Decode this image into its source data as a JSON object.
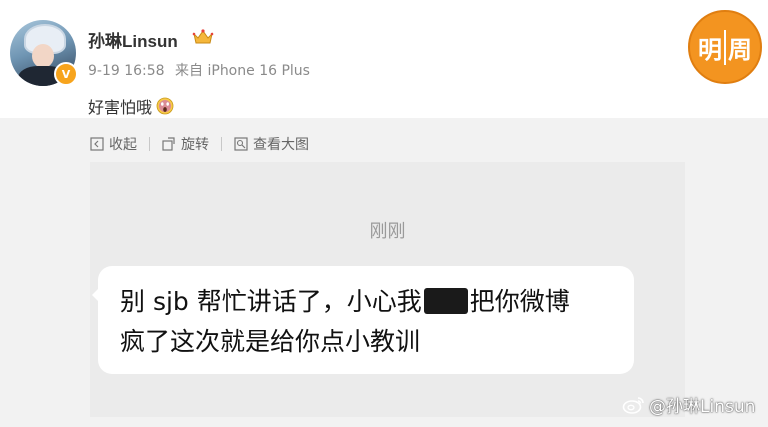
{
  "post": {
    "username": "孙琳Linsun",
    "time": "9-19 16:58",
    "source": "来自 iPhone 16 Plus",
    "text": "好害怕哦"
  },
  "logo": {
    "char1": "明",
    "char2": "周"
  },
  "toolbar": {
    "collapse_label": "收起",
    "rotate_label": "旋转",
    "view_large_label": "查看大图"
  },
  "chat_screenshot": {
    "time_label": "刚刚",
    "line1_before": "别 sjb 帮忙讲话了，小心我",
    "line1_after": "把你微博",
    "line2": "疯了这次就是给你点小教训"
  },
  "watermark": {
    "text": "@孙琳Linsun"
  },
  "colors": {
    "verified_badge": "#f7a41d",
    "logo_orange": "#f39420",
    "meta_gray": "#8a8a8a",
    "image_bg": "#f2f2f2"
  },
  "icons": [
    "avatar",
    "verified-v-icon",
    "crown-icon",
    "scream-emoji-icon",
    "collapse-icon",
    "rotate-icon",
    "view-large-icon",
    "weibo-icon"
  ]
}
